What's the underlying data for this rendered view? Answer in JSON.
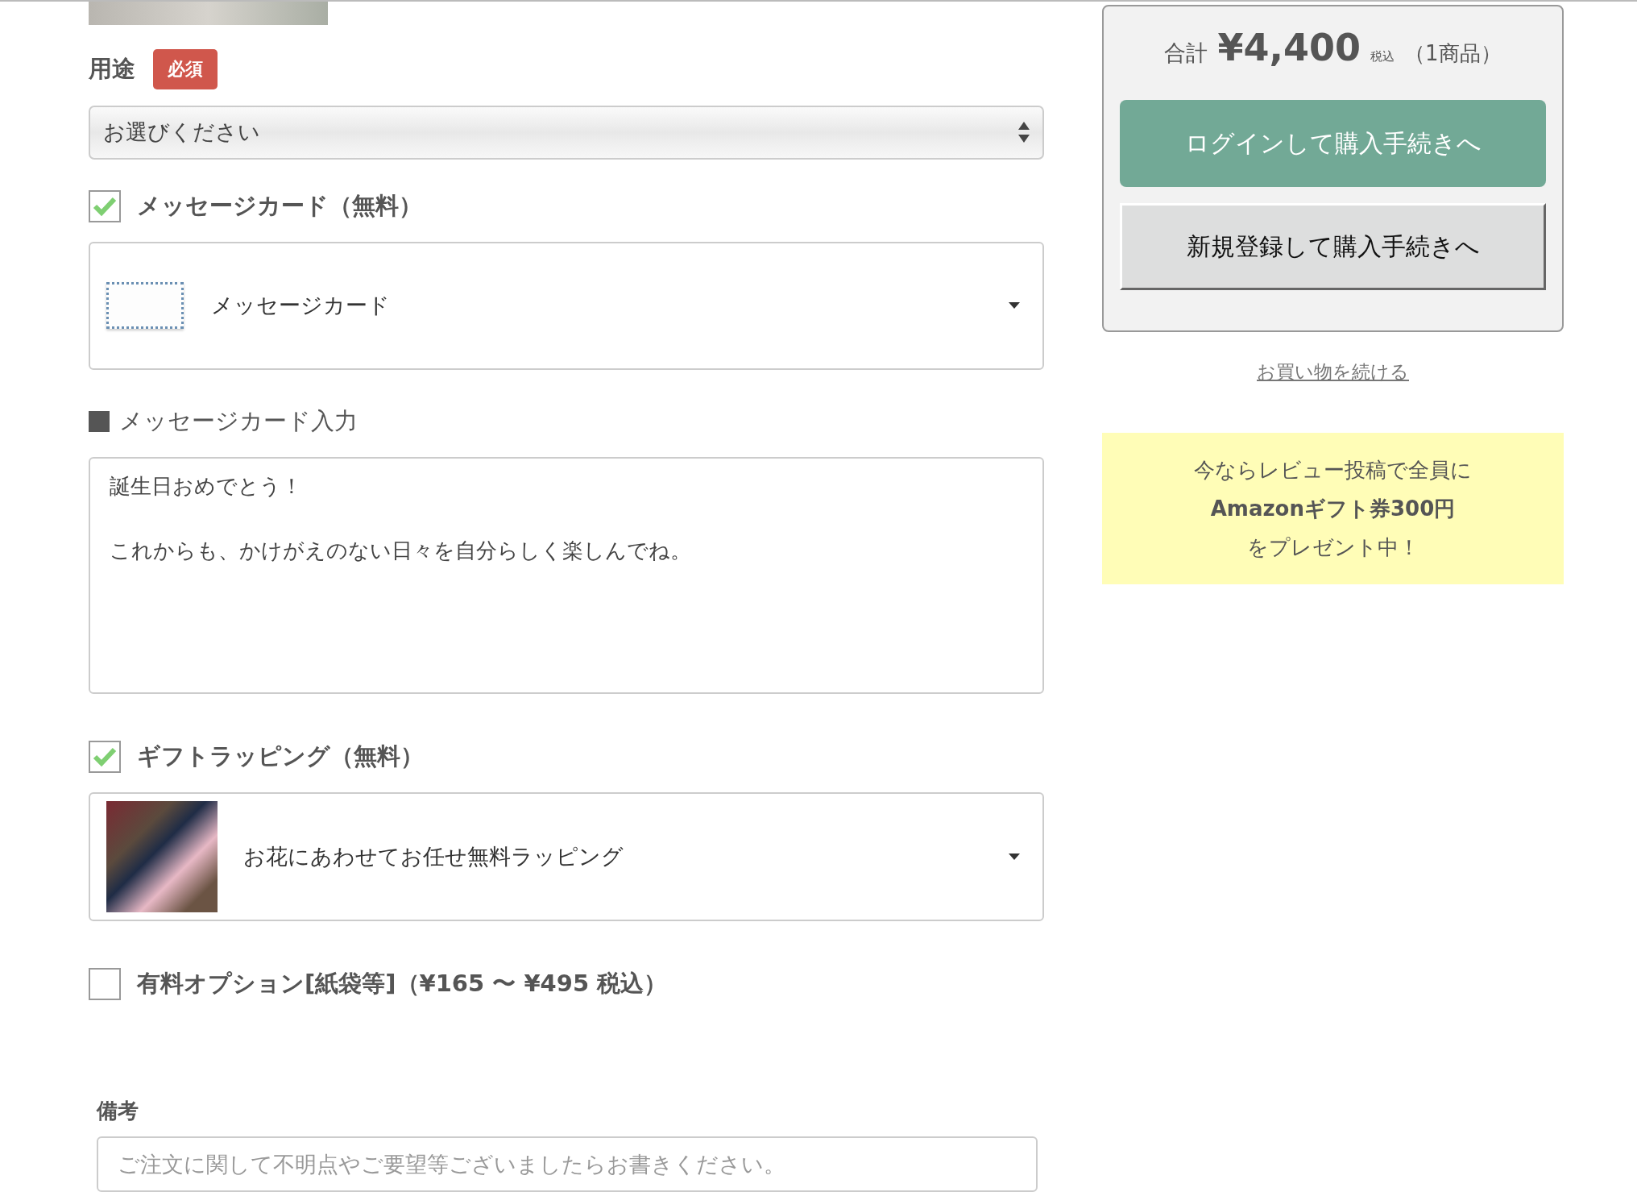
{
  "purpose": {
    "label": "用途",
    "badge": "必須",
    "select": {
      "value": "お選びください"
    }
  },
  "message_card": {
    "label": "メッセージカード（無料）",
    "checked": true,
    "option": "メッセージカード"
  },
  "message_input": {
    "heading": "メッセージカード入力",
    "lines": [
      "誕生日おめでとう！",
      "これからも、かけがえのない日々を自分らしく楽しんでね。"
    ]
  },
  "gift_wrapping": {
    "label": "ギフトラッピング（無料）",
    "checked": true,
    "option": "お花にあわせてお任せ無料ラッピング"
  },
  "paid_option": {
    "label": "有料オプション[紙袋等]（¥165 〜 ¥495 税込）",
    "checked": false
  },
  "notes": {
    "label": "備考",
    "placeholder": "ご注文に関して不明点やご要望等ございましたらお書きください。"
  },
  "summary": {
    "total_label": "合計",
    "total": "¥4,400",
    "tax_note": "税込",
    "count": "（1商品）",
    "buttons": [
      {
        "label": "ログインして購入手続きへ",
        "kind": "primary"
      },
      {
        "label": "新規登録して購入手続きへ",
        "kind": "secondary"
      }
    ]
  },
  "continue_link": "お買い物を続ける",
  "promo": {
    "lines": [
      {
        "text": "今ならレビュー投稿で全員に",
        "bold": false
      },
      {
        "text": "Amazonギフト券300円",
        "bold": true
      },
      {
        "text": "をプレゼント中！",
        "bold": false
      }
    ]
  }
}
